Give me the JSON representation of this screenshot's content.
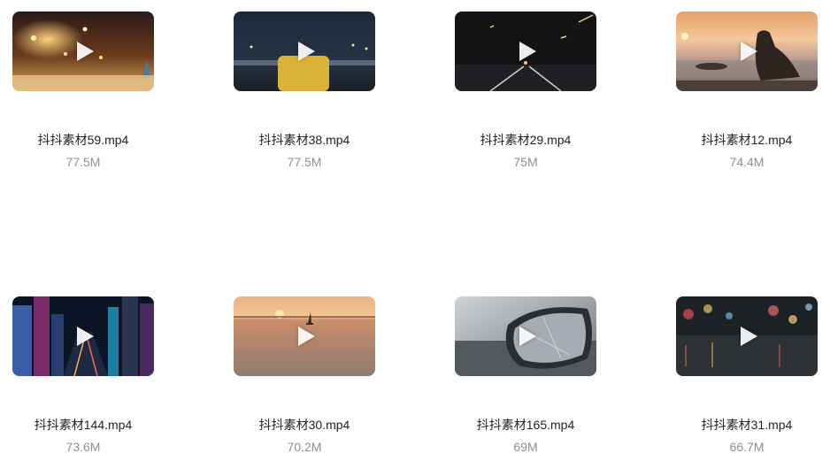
{
  "files": [
    {
      "name": "抖抖素材59.mp4",
      "size": "77.5M",
      "thumbnail": "night-street-lights-scene"
    },
    {
      "name": "抖抖素材38.mp4",
      "size": "77.5M",
      "thumbnail": "night-river-suitcase-scene"
    },
    {
      "name": "抖抖素材29.mp4",
      "size": "75M",
      "thumbnail": "night-highway-drive-scene"
    },
    {
      "name": "抖抖素材12.mp4",
      "size": "74.4M",
      "thumbnail": "sunset-sea-woman-scene"
    },
    {
      "name": "抖抖素材144.mp4",
      "size": "73.6M",
      "thumbnail": "neon-city-skyline-scene"
    },
    {
      "name": "抖抖素材30.mp4",
      "size": "70.2M",
      "thumbnail": "sunset-sea-sailboat-scene"
    },
    {
      "name": "抖抖素材165.mp4",
      "size": "69M",
      "thumbnail": "rainy-car-mirror-scene"
    },
    {
      "name": "抖抖素材31.mp4",
      "size": "66.7M",
      "thumbnail": "rain-bokeh-street-scene"
    }
  ]
}
